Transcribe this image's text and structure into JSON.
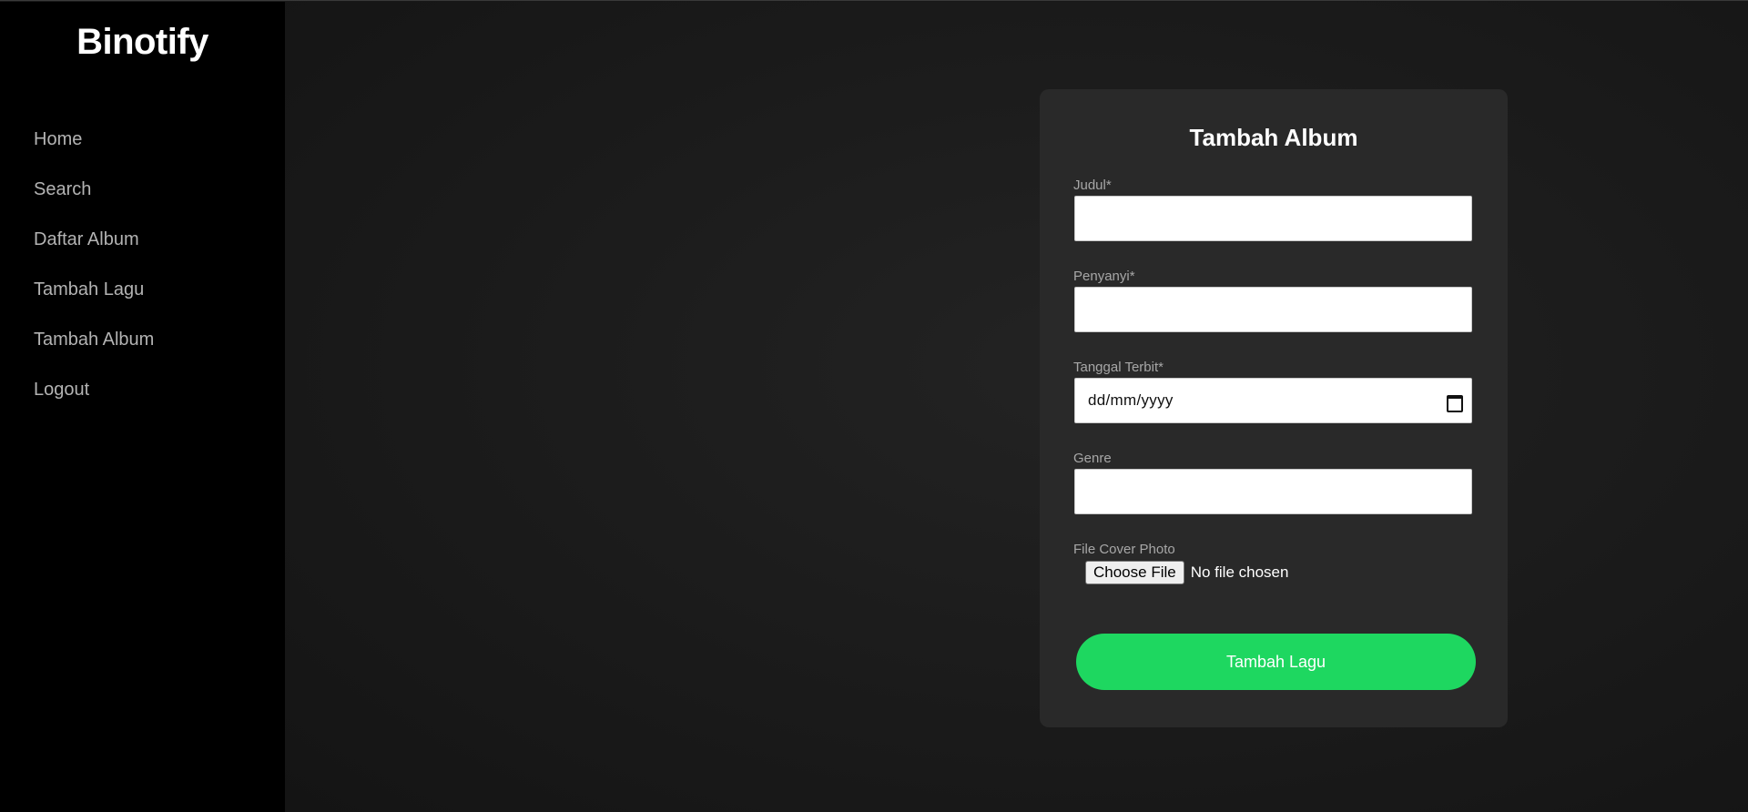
{
  "app": {
    "logo": "Binotify"
  },
  "sidebar": {
    "items": [
      {
        "label": "Home"
      },
      {
        "label": "Search"
      },
      {
        "label": "Daftar Album"
      },
      {
        "label": "Tambah Lagu"
      },
      {
        "label": "Tambah Album"
      },
      {
        "label": "Logout"
      }
    ]
  },
  "form": {
    "title": "Tambah Album",
    "judul": {
      "label": "Judul*",
      "value": ""
    },
    "penyanyi": {
      "label": "Penyanyi*",
      "value": ""
    },
    "tanggal": {
      "label": "Tanggal Terbit*",
      "placeholder": "dd/mm/yyyy"
    },
    "genre": {
      "label": "Genre",
      "value": ""
    },
    "cover": {
      "label": "File Cover Photo",
      "button": "Choose File",
      "status": "No file chosen"
    },
    "submit": "Tambah Lagu"
  },
  "colors": {
    "accent": "#1ed760",
    "sidebar_bg": "#000000",
    "card_bg": "#292929"
  },
  "icons": {
    "date_picker": "calendar-icon"
  }
}
